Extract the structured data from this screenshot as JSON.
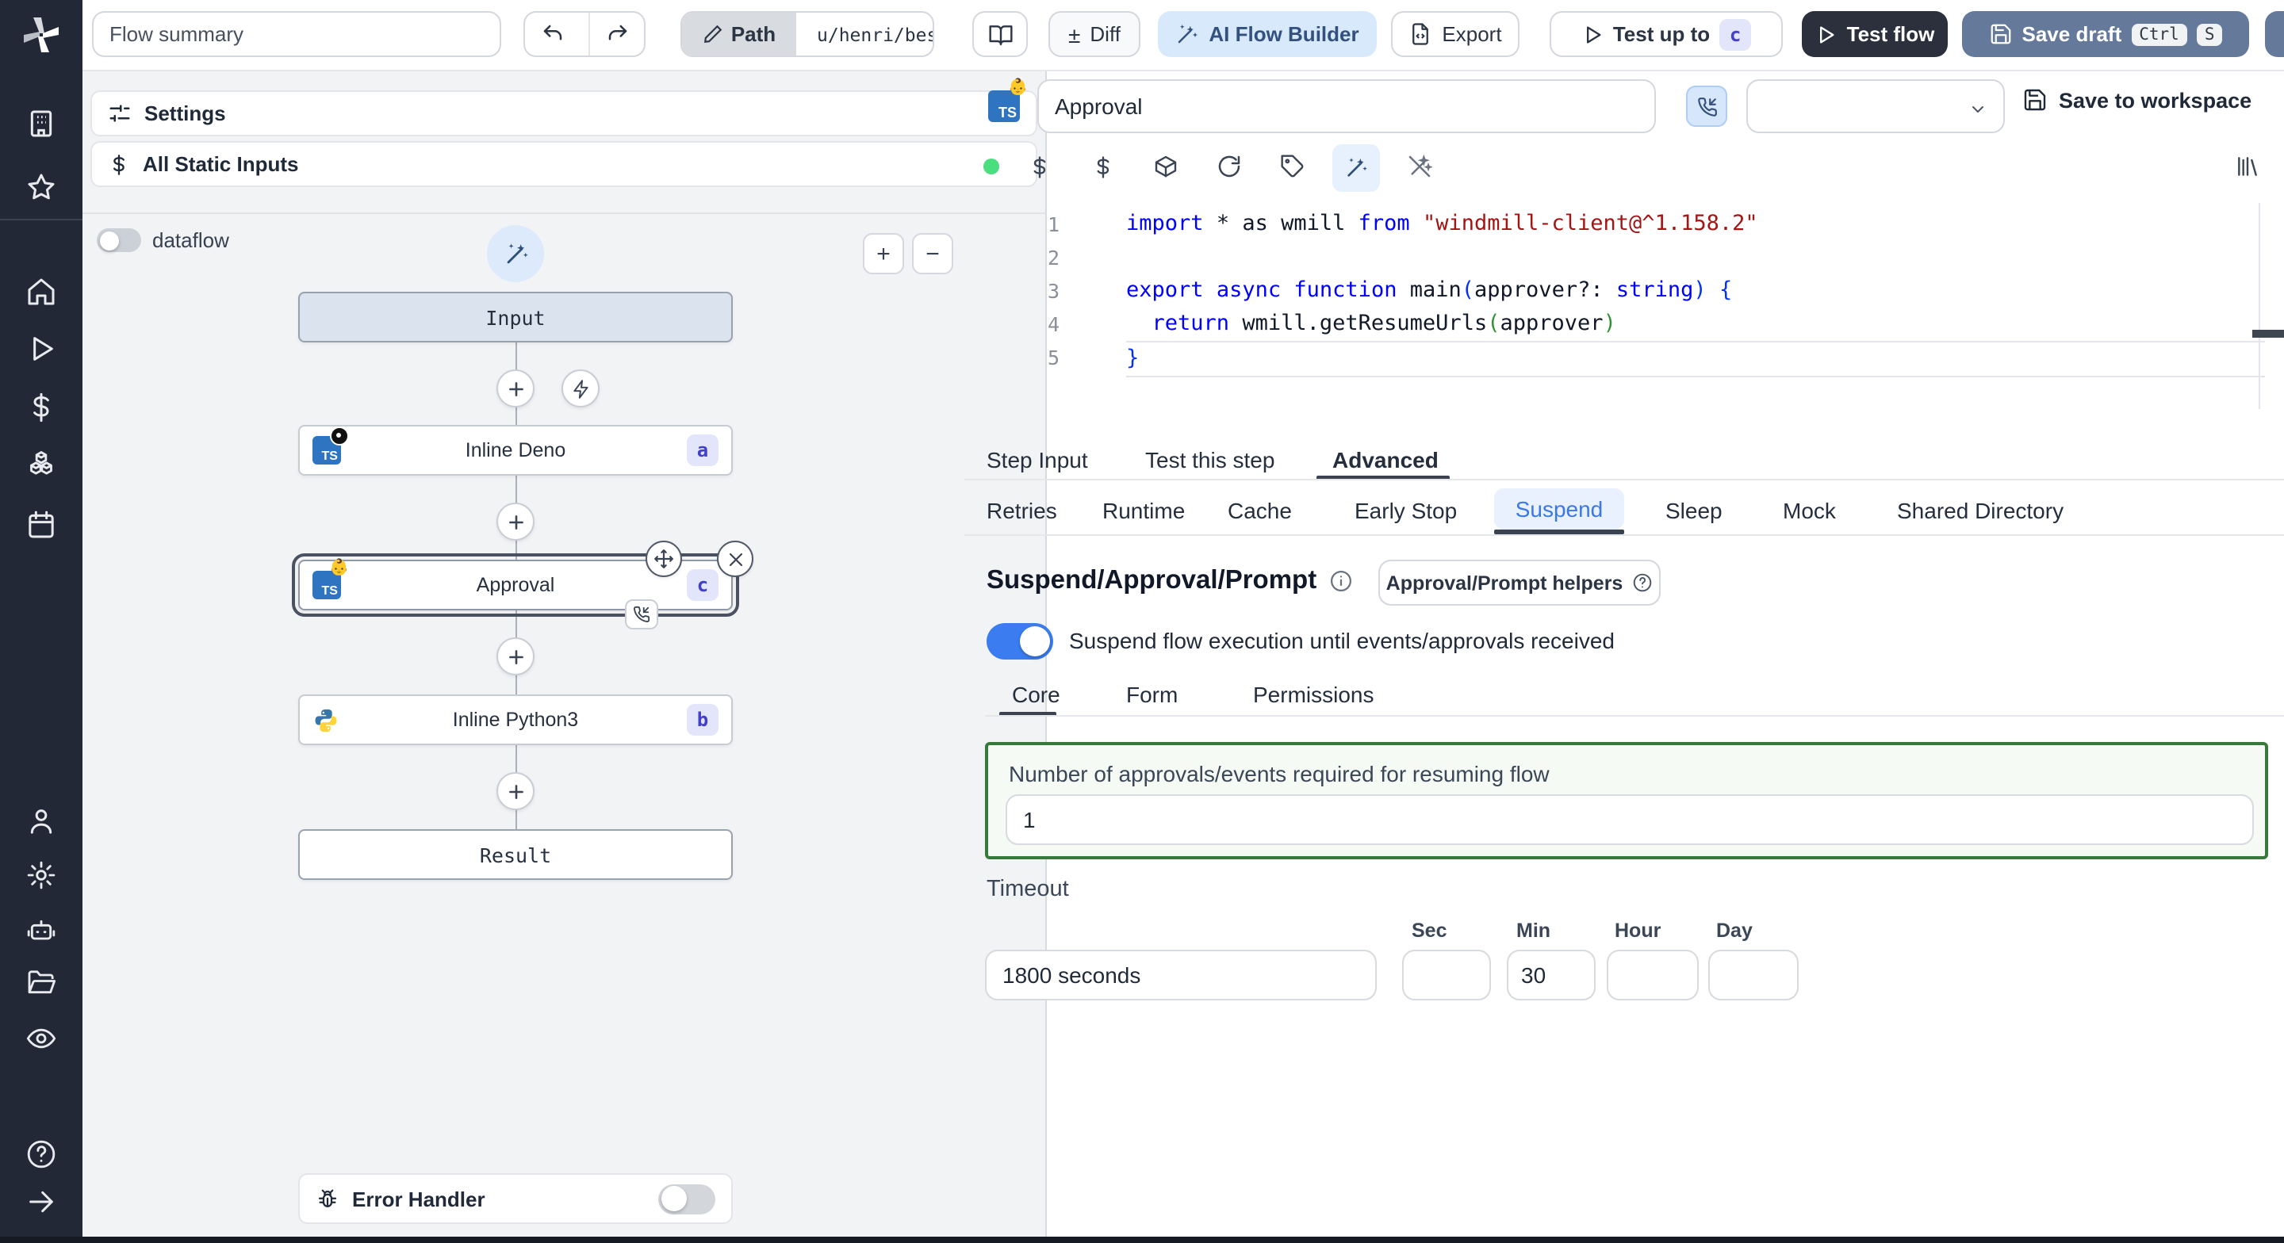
{
  "topbar": {
    "flow_summary_value": "Flow summary",
    "undo_icon": "undo-arrow",
    "redo_icon": "redo-arrow",
    "path_label": "Path",
    "path_value": "u/henri/bes",
    "book_icon": "book-open",
    "diff_sign": "±",
    "diff_label": "Diff",
    "ai_flow_builder_label": "AI Flow Builder",
    "export_label": "Export",
    "test_up_to_label": "Test up to",
    "test_up_to_badge": "c",
    "test_flow_label": "Test flow",
    "save_draft_label": "Save draft",
    "kbd_ctrl": "Ctrl",
    "kbd_s": "S"
  },
  "sidebar": {
    "icons": [
      "windmill-logo",
      "building",
      "star",
      "home",
      "play",
      "dollar",
      "boxes",
      "calendar",
      "user",
      "gear",
      "bot",
      "folder-open",
      "eye",
      "help-circle",
      "arrow-right"
    ]
  },
  "left_panel": {
    "settings_label": "Settings",
    "static_inputs_label": "All Static Inputs",
    "dataflow_label": "dataflow",
    "zoom_in": "+",
    "zoom_out": "−",
    "error_handler_label": "Error Handler"
  },
  "flow": {
    "input_label": "Input",
    "result_label": "Result",
    "nodes": [
      {
        "title": "Inline Deno",
        "badge": "a",
        "lang": "deno"
      },
      {
        "title": "Approval",
        "badge": "c",
        "lang": "approval",
        "emoji": "👶"
      },
      {
        "title": "Inline Python3",
        "badge": "b",
        "lang": "python3"
      }
    ],
    "plus_glyph": "+"
  },
  "step_header": {
    "name_value": "Approval",
    "emoji": "👶",
    "save_to_workspace_label": "Save to workspace"
  },
  "editor": {
    "line_numbers": [
      "1",
      "2",
      "3",
      "4",
      "5"
    ],
    "lines": [
      [
        [
          "k",
          "import"
        ],
        [
          "p",
          " * as wmill "
        ],
        [
          "k",
          "from"
        ],
        [
          "p",
          " "
        ],
        [
          "s",
          "\"windmill-client@^1.158.2\""
        ]
      ],
      [],
      [
        [
          "k",
          "export"
        ],
        [
          "p",
          " "
        ],
        [
          "k",
          "async"
        ],
        [
          "p",
          " "
        ],
        [
          "k",
          "function"
        ],
        [
          "p",
          " main"
        ],
        [
          "u",
          "("
        ],
        [
          "p",
          "approver?: "
        ],
        [
          "k",
          "string"
        ],
        [
          "u",
          ")"
        ],
        [
          "p",
          " "
        ],
        [
          "u",
          "{"
        ]
      ],
      [
        [
          "p",
          "  "
        ],
        [
          "k",
          "return"
        ],
        [
          "p",
          " wmill.getResumeUrls"
        ],
        [
          "g",
          "("
        ],
        [
          "p",
          "approver"
        ],
        [
          "g",
          ")"
        ]
      ],
      [
        [
          "u",
          "}"
        ]
      ]
    ]
  },
  "tabs": {
    "items": [
      {
        "label": "Step Input"
      },
      {
        "label": "Test this step"
      },
      {
        "label": "Advanced",
        "active": true
      }
    ]
  },
  "advanced_tabs": {
    "items": [
      {
        "label": "Retries"
      },
      {
        "label": "Runtime"
      },
      {
        "label": "Cache"
      },
      {
        "label": "Early Stop"
      },
      {
        "label": "Suspend",
        "active": true
      },
      {
        "label": "Sleep"
      },
      {
        "label": "Mock"
      },
      {
        "label": "Shared Directory"
      }
    ]
  },
  "suspend": {
    "title": "Suspend/Approval/Prompt",
    "helpers_button_label": "Approval/Prompt helpers",
    "toggle_on": true,
    "toggle_label": "Suspend flow execution until events/approvals received",
    "sub_tabs": [
      {
        "label": "Core",
        "active": true
      },
      {
        "label": "Form"
      },
      {
        "label": "Permissions"
      }
    ],
    "approvals_label": "Number of approvals/events required for resuming flow",
    "approvals_value": "1",
    "timeout_label": "Timeout",
    "timeout_value": "1800 seconds",
    "sec_label": "Sec",
    "sec_value": "",
    "min_label": "Min",
    "min_value": "30",
    "hour_label": "Hour",
    "hour_value": "",
    "day_label": "Day",
    "day_value": ""
  },
  "colors": {
    "sidebar_bg": "#222836",
    "accent_blue": "#3b7df0",
    "ai_button_bg": "#d9e9fc",
    "save_draft_bg": "#65799b",
    "test_flow_bg": "#2b303c",
    "badge_bg": "#e3e6fb",
    "badge_text": "#4240c8",
    "suspend_active": "#3a78e7",
    "green_border": "#38793b",
    "keyword": "#0000ff",
    "string": "#a31515",
    "status_dot": "#4ade80"
  }
}
